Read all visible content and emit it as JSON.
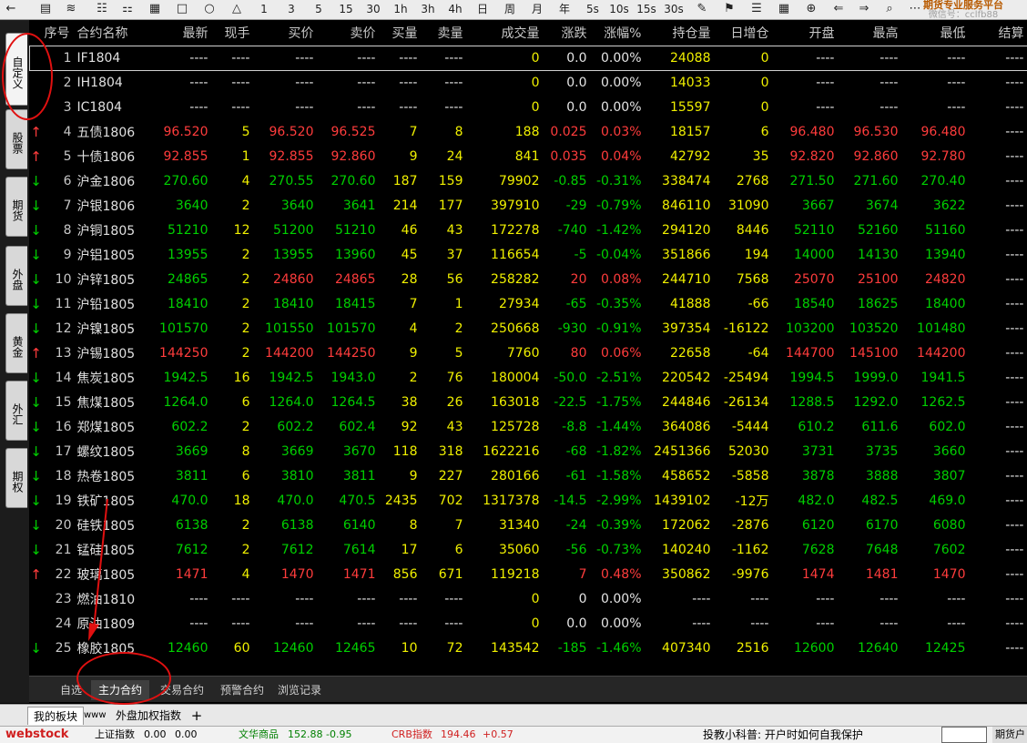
{
  "toolbar": {
    "icons": [
      "back-icon",
      "doc-icon",
      "chart-line-icon",
      "sector-icon",
      "compare-icon",
      "calendar-icon",
      "window-icon",
      "circle-icon",
      "chart-icon"
    ],
    "periods": [
      "1",
      "3",
      "5",
      "15",
      "30",
      "1h",
      "3h",
      "4h",
      "日",
      "周",
      "月",
      "年",
      "5s",
      "10s",
      "15s",
      "30s"
    ],
    "brand_line1": "期货专业服务平台",
    "brand_line2": "微信号：cclfb88"
  },
  "side_tabs": [
    "自定义",
    "股票",
    "期货",
    "外盘",
    "黄金",
    "外汇",
    "期权"
  ],
  "table": {
    "headers": [
      "序号",
      "合约名称",
      "最新",
      "现手",
      "买价",
      "卖价",
      "买量",
      "卖量",
      "成交量",
      "涨跌",
      "涨幅%",
      "持仓量",
      "日增仓",
      "开盘",
      "最高",
      "最低",
      "结算"
    ],
    "rows": [
      {
        "arrow": "",
        "idx": "1",
        "name": "IF1804",
        "last": "----",
        "hand": "----",
        "bid": "----",
        "ask": "----",
        "bv": "----",
        "av": "----",
        "vol": "0",
        "chg": "0.0",
        "pct": "0.00%",
        "oi": "24088",
        "doi": "0",
        "open": "----",
        "high": "----",
        "low": "----",
        "settle": "----",
        "dir": "flat"
      },
      {
        "arrow": "",
        "idx": "2",
        "name": "IH1804",
        "last": "----",
        "hand": "----",
        "bid": "----",
        "ask": "----",
        "bv": "----",
        "av": "----",
        "vol": "0",
        "chg": "0.0",
        "pct": "0.00%",
        "oi": "14033",
        "doi": "0",
        "open": "----",
        "high": "----",
        "low": "----",
        "settle": "----",
        "dir": "flat"
      },
      {
        "arrow": "",
        "idx": "3",
        "name": "IC1804",
        "last": "----",
        "hand": "----",
        "bid": "----",
        "ask": "----",
        "bv": "----",
        "av": "----",
        "vol": "0",
        "chg": "0.0",
        "pct": "0.00%",
        "oi": "15597",
        "doi": "0",
        "open": "----",
        "high": "----",
        "low": "----",
        "settle": "----",
        "dir": "flat"
      },
      {
        "arrow": "↑",
        "idx": "4",
        "name": "五债1806",
        "last": "96.520",
        "hand": "5",
        "bid": "96.520",
        "ask": "96.525",
        "bv": "7",
        "av": "8",
        "vol": "188",
        "chg": "0.025",
        "pct": "0.03%",
        "oi": "18157",
        "doi": "6",
        "open": "96.480",
        "high": "96.530",
        "low": "96.480",
        "settle": "----",
        "dir": "up"
      },
      {
        "arrow": "↑",
        "idx": "5",
        "name": "十债1806",
        "last": "92.855",
        "hand": "1",
        "bid": "92.855",
        "ask": "92.860",
        "bv": "9",
        "av": "24",
        "vol": "841",
        "chg": "0.035",
        "pct": "0.04%",
        "oi": "42792",
        "doi": "35",
        "open": "92.820",
        "high": "92.860",
        "low": "92.780",
        "settle": "----",
        "dir": "up"
      },
      {
        "arrow": "↓",
        "idx": "6",
        "name": "沪金1806",
        "last": "270.60",
        "hand": "4",
        "bid": "270.55",
        "ask": "270.60",
        "bv": "187",
        "av": "159",
        "vol": "79902",
        "chg": "-0.85",
        "pct": "-0.31%",
        "oi": "338474",
        "doi": "2768",
        "open": "271.50",
        "high": "271.60",
        "low": "270.40",
        "settle": "----",
        "dir": "down"
      },
      {
        "arrow": "↓",
        "idx": "7",
        "name": "沪银1806",
        "last": "3640",
        "hand": "2",
        "bid": "3640",
        "ask": "3641",
        "bv": "214",
        "av": "177",
        "vol": "397910",
        "chg": "-29",
        "pct": "-0.79%",
        "oi": "846110",
        "doi": "31090",
        "open": "3667",
        "high": "3674",
        "low": "3622",
        "settle": "----",
        "dir": "down"
      },
      {
        "arrow": "↓",
        "idx": "8",
        "name": "沪铜1805",
        "last": "51210",
        "hand": "12",
        "bid": "51200",
        "ask": "51210",
        "bv": "46",
        "av": "43",
        "vol": "172278",
        "chg": "-740",
        "pct": "-1.42%",
        "oi": "294120",
        "doi": "8446",
        "open": "52110",
        "high": "52160",
        "low": "51160",
        "settle": "----",
        "dir": "down"
      },
      {
        "arrow": "↓",
        "idx": "9",
        "name": "沪铝1805",
        "last": "13955",
        "hand": "2",
        "bid": "13955",
        "ask": "13960",
        "bv": "45",
        "av": "37",
        "vol": "116654",
        "chg": "-5",
        "pct": "-0.04%",
        "oi": "351866",
        "doi": "194",
        "open": "14000",
        "high": "14130",
        "low": "13940",
        "settle": "----",
        "dir": "down"
      },
      {
        "arrow": "↓",
        "idx": "10",
        "name": "沪锌1805",
        "last": "24865",
        "hand": "2",
        "bid": "24860",
        "ask": "24865",
        "bv": "28",
        "av": "56",
        "vol": "258282",
        "chg": "20",
        "pct": "0.08%",
        "oi": "244710",
        "doi": "7568",
        "open": "25070",
        "high": "25100",
        "low": "24820",
        "settle": "----",
        "dir": "mixup"
      },
      {
        "arrow": "↓",
        "idx": "11",
        "name": "沪铅1805",
        "last": "18410",
        "hand": "2",
        "bid": "18410",
        "ask": "18415",
        "bv": "7",
        "av": "1",
        "vol": "27934",
        "chg": "-65",
        "pct": "-0.35%",
        "oi": "41888",
        "doi": "-66",
        "open": "18540",
        "high": "18625",
        "low": "18400",
        "settle": "----",
        "dir": "down"
      },
      {
        "arrow": "↓",
        "idx": "12",
        "name": "沪镍1805",
        "last": "101570",
        "hand": "2",
        "bid": "101550",
        "ask": "101570",
        "bv": "4",
        "av": "2",
        "vol": "250668",
        "chg": "-930",
        "pct": "-0.91%",
        "oi": "397354",
        "doi": "-16122",
        "open": "103200",
        "high": "103520",
        "low": "101480",
        "settle": "----",
        "dir": "down"
      },
      {
        "arrow": "↑",
        "idx": "13",
        "name": "沪锡1805",
        "last": "144250",
        "hand": "2",
        "bid": "144200",
        "ask": "144250",
        "bv": "9",
        "av": "5",
        "vol": "7760",
        "chg": "80",
        "pct": "0.06%",
        "oi": "22658",
        "doi": "-64",
        "open": "144700",
        "high": "145100",
        "low": "144200",
        "settle": "----",
        "dir": "up"
      },
      {
        "arrow": "↓",
        "idx": "14",
        "name": "焦炭1805",
        "last": "1942.5",
        "hand": "16",
        "bid": "1942.5",
        "ask": "1943.0",
        "bv": "2",
        "av": "76",
        "vol": "180004",
        "chg": "-50.0",
        "pct": "-2.51%",
        "oi": "220542",
        "doi": "-25494",
        "open": "1994.5",
        "high": "1999.0",
        "low": "1941.5",
        "settle": "----",
        "dir": "down"
      },
      {
        "arrow": "↓",
        "idx": "15",
        "name": "焦煤1805",
        "last": "1264.0",
        "hand": "6",
        "bid": "1264.0",
        "ask": "1264.5",
        "bv": "38",
        "av": "26",
        "vol": "163018",
        "chg": "-22.5",
        "pct": "-1.75%",
        "oi": "244846",
        "doi": "-26134",
        "open": "1288.5",
        "high": "1292.0",
        "low": "1262.5",
        "settle": "----",
        "dir": "down"
      },
      {
        "arrow": "↓",
        "idx": "16",
        "name": "郑煤1805",
        "last": "602.2",
        "hand": "2",
        "bid": "602.2",
        "ask": "602.4",
        "bv": "92",
        "av": "43",
        "vol": "125728",
        "chg": "-8.8",
        "pct": "-1.44%",
        "oi": "364086",
        "doi": "-5444",
        "open": "610.2",
        "high": "611.6",
        "low": "602.0",
        "settle": "----",
        "dir": "down"
      },
      {
        "arrow": "↓",
        "idx": "17",
        "name": "螺纹1805",
        "last": "3669",
        "hand": "8",
        "bid": "3669",
        "ask": "3670",
        "bv": "118",
        "av": "318",
        "vol": "1622216",
        "chg": "-68",
        "pct": "-1.82%",
        "oi": "2451366",
        "doi": "52030",
        "open": "3731",
        "high": "3735",
        "low": "3660",
        "settle": "----",
        "dir": "down"
      },
      {
        "arrow": "↓",
        "idx": "18",
        "name": "热卷1805",
        "last": "3811",
        "hand": "6",
        "bid": "3810",
        "ask": "3811",
        "bv": "9",
        "av": "227",
        "vol": "280166",
        "chg": "-61",
        "pct": "-1.58%",
        "oi": "458652",
        "doi": "-5858",
        "open": "3878",
        "high": "3888",
        "low": "3807",
        "settle": "----",
        "dir": "down"
      },
      {
        "arrow": "↓",
        "idx": "19",
        "name": "铁矿1805",
        "last": "470.0",
        "hand": "18",
        "bid": "470.0",
        "ask": "470.5",
        "bv": "2435",
        "av": "702",
        "vol": "1317378",
        "chg": "-14.5",
        "pct": "-2.99%",
        "oi": "1439102",
        "doi": "-12万",
        "open": "482.0",
        "high": "482.5",
        "low": "469.0",
        "settle": "----",
        "dir": "down"
      },
      {
        "arrow": "↓",
        "idx": "20",
        "name": "硅铁1805",
        "last": "6138",
        "hand": "2",
        "bid": "6138",
        "ask": "6140",
        "bv": "8",
        "av": "7",
        "vol": "31340",
        "chg": "-24",
        "pct": "-0.39%",
        "oi": "172062",
        "doi": "-2876",
        "open": "6120",
        "high": "6170",
        "low": "6080",
        "settle": "----",
        "dir": "down"
      },
      {
        "arrow": "↓",
        "idx": "21",
        "name": "锰硅1805",
        "last": "7612",
        "hand": "2",
        "bid": "7612",
        "ask": "7614",
        "bv": "17",
        "av": "6",
        "vol": "35060",
        "chg": "-56",
        "pct": "-0.73%",
        "oi": "140240",
        "doi": "-1162",
        "open": "7628",
        "high": "7648",
        "low": "7602",
        "settle": "----",
        "dir": "down"
      },
      {
        "arrow": "↑",
        "idx": "22",
        "name": "玻璃1805",
        "last": "1471",
        "hand": "4",
        "bid": "1470",
        "ask": "1471",
        "bv": "856",
        "av": "671",
        "vol": "119218",
        "chg": "7",
        "pct": "0.48%",
        "oi": "350862",
        "doi": "-9976",
        "open": "1474",
        "high": "1481",
        "low": "1470",
        "settle": "----",
        "dir": "up"
      },
      {
        "arrow": "",
        "idx": "23",
        "name": "燃油1810",
        "last": "----",
        "hand": "----",
        "bid": "----",
        "ask": "----",
        "bv": "----",
        "av": "----",
        "vol": "0",
        "chg": "0",
        "pct": "0.00%",
        "oi": "----",
        "doi": "----",
        "open": "----",
        "high": "----",
        "low": "----",
        "settle": "----",
        "dir": "flat"
      },
      {
        "arrow": "",
        "idx": "24",
        "name": "原油1809",
        "last": "----",
        "hand": "----",
        "bid": "----",
        "ask": "----",
        "bv": "----",
        "av": "----",
        "vol": "0",
        "chg": "0.0",
        "pct": "0.00%",
        "oi": "----",
        "doi": "----",
        "open": "----",
        "high": "----",
        "low": "----",
        "settle": "----",
        "dir": "flat"
      },
      {
        "arrow": "↓",
        "idx": "25",
        "name": "橡胶1805",
        "last": "12460",
        "hand": "60",
        "bid": "12460",
        "ask": "12465",
        "bv": "10",
        "av": "72",
        "vol": "143542",
        "chg": "-185",
        "pct": "-1.46%",
        "oi": "407340",
        "doi": "2516",
        "open": "12600",
        "high": "12640",
        "low": "12425",
        "settle": "----",
        "dir": "down"
      }
    ]
  },
  "subtabs": [
    "自选",
    "主力合约",
    "交易合约",
    "预警合约",
    "浏览记录"
  ],
  "subtab_active": "主力合约",
  "board_tabs": [
    "我的板块",
    "外盘加权指数"
  ],
  "board_add": "+",
  "board_www": "www",
  "status": {
    "logo": "webstock",
    "index1_label": "上证指数",
    "index1_value": "0.00",
    "index1_change": "0.00",
    "index2_label": "文华商品",
    "index2_value": "152.88",
    "index2_change": "-0.95",
    "index3_label": "CRB指数",
    "index3_value": "194.46",
    "index3_change": "+0.57",
    "notice": "投教小科普: 开户时如何自我保护",
    "right_btn": "期货户"
  },
  "colors": {
    "up": "#ff3c3c",
    "down": "#00d000",
    "neutral": "#e4e4e4",
    "volume": "#f0f000",
    "annotation": "#e01010"
  }
}
